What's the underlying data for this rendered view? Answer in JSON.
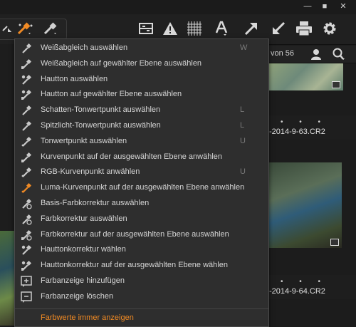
{
  "window": {
    "minimize": "—",
    "maximize": "■",
    "close": "✕"
  },
  "toolbar": {
    "icons": [
      "color-picker-icon",
      "eyedropper-icon",
      "grid-icon",
      "warning-icon",
      "focus-grid-icon",
      "text-icon",
      "arrow-up-right-icon",
      "arrow-down-left-icon",
      "print-icon",
      "gear-icon"
    ]
  },
  "browser": {
    "count_label": "von 56",
    "thumbnails": [
      {
        "dots": "• • •",
        "filename": "-2014-9-63.CR2"
      },
      {
        "dots": "• • •",
        "filename": "-2014-9-64.CR2"
      }
    ]
  },
  "menu": {
    "items": [
      {
        "label": "Weißabgleich auswählen",
        "shortcut": "W",
        "icon": "eyedropper-icon"
      },
      {
        "label": "Weißabgleich auf gewählter Ebene auswählen",
        "shortcut": "",
        "icon": "eyedropper-layer-icon"
      },
      {
        "label": "Hautton auswählen",
        "shortcut": "",
        "icon": "skin-eyedropper-icon"
      },
      {
        "label": "Hautton auf gewählter Ebene auswählen",
        "shortcut": "",
        "icon": "skin-eyedropper-layer-icon"
      },
      {
        "label": "Schatten-Tonwertpunkt auswählen",
        "shortcut": "L",
        "icon": "shadow-eyedropper-icon"
      },
      {
        "label": "Spitzlicht-Tonwertpunkt auswählen",
        "shortcut": "L",
        "icon": "highlight-eyedropper-icon"
      },
      {
        "label": "Tonwertpunkt auswählen",
        "shortcut": "U",
        "icon": "level-eyedropper-icon"
      },
      {
        "label": "Kurvenpunkt auf der ausgewählten Ebene anwählen",
        "shortcut": "",
        "icon": "curve-eyedropper-layer-icon"
      },
      {
        "label": "RGB-Kurvenpunkt anwählen",
        "shortcut": "U",
        "icon": "rgb-curve-eyedropper-icon"
      },
      {
        "label": "Luma-Kurvenpunkt auf der ausgewählten Ebene anwählen",
        "shortcut": "",
        "icon": "luma-curve-eyedropper-icon"
      },
      {
        "label": "Basis-Farbkorrektur auswählen",
        "shortcut": "",
        "icon": "basic-color-eyedropper-icon"
      },
      {
        "label": "Farbkorrektur auswählen",
        "shortcut": "",
        "icon": "color-correction-eyedropper-icon"
      },
      {
        "label": "Farbkorrektur auf der ausgewählten Ebene auswählen",
        "shortcut": "",
        "icon": "color-correction-layer-icon"
      },
      {
        "label": "Hauttonkorrektur wählen",
        "shortcut": "",
        "icon": "skin-correction-eyedropper-icon"
      },
      {
        "label": "Hauttonkorrektur auf der ausgewählten Ebene wählen",
        "shortcut": "",
        "icon": "skin-correction-layer-icon"
      },
      {
        "label": "Farbanzeige hinzufügen",
        "shortcut": "",
        "icon": "add-readout-icon"
      },
      {
        "label": "Farbanzeige löschen",
        "shortcut": "",
        "icon": "delete-readout-icon"
      },
      {
        "label": "Farbwerte immer anzeigen",
        "shortcut": "",
        "icon": ""
      }
    ]
  },
  "colors": {
    "accent": "#f08a24",
    "menu_bg": "#2e2e2e",
    "icon_grey": "#c8c8c8"
  }
}
